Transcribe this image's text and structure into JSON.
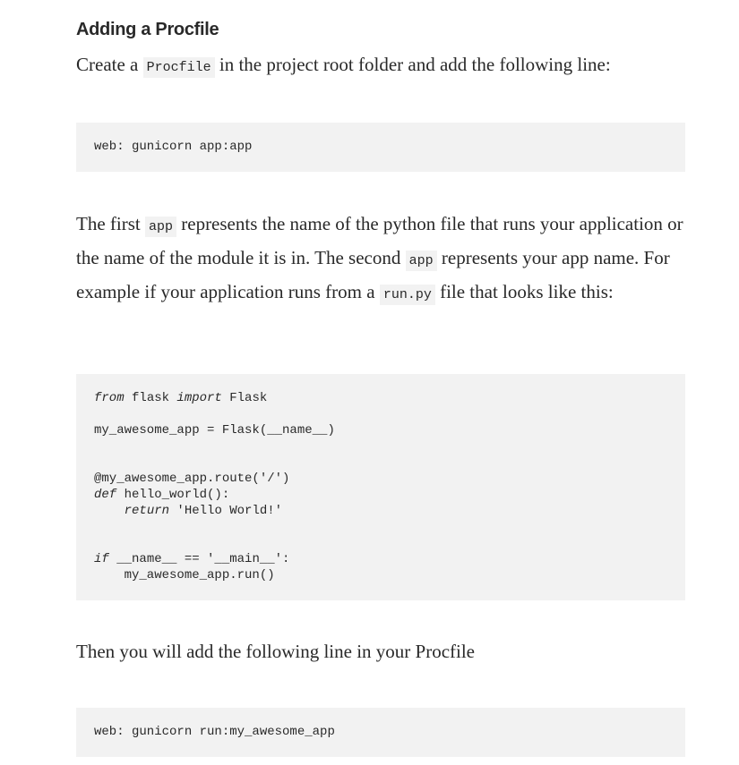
{
  "heading": "Adding a Procfile",
  "intro": {
    "before": "Create a ",
    "code": "Procfile",
    "after": " in the project root folder and add the following line:"
  },
  "code_block_1": "web: gunicorn app:app",
  "explain": {
    "t1": "The first ",
    "c1": "app",
    "t2": " represents the name of the python file that runs your application or the name of the module it is in. The second ",
    "c2": "app",
    "t3": " represents your app name. For example if your application runs from a ",
    "c3": "run.py",
    "t4": " file that looks like this:"
  },
  "code_block_2": {
    "l1_kw1": "from",
    "l1_mid": " flask ",
    "l1_kw2": "import",
    "l1_end": " Flask",
    "l2": "my_awesome_app = Flask(__name__)",
    "l3": "@my_awesome_app.route('/')",
    "l4_kw": "def",
    "l4_rest": " hello_world():",
    "l5_indent": "    ",
    "l5_kw": "return",
    "l5_rest": " 'Hello World!'",
    "l6_kw": "if",
    "l6_rest": " __name__ == '__main__':",
    "l7": "    my_awesome_app.run()"
  },
  "then_text": "Then you will add the following line in your Procfile",
  "code_block_3": "web: gunicorn run:my_awesome_app"
}
